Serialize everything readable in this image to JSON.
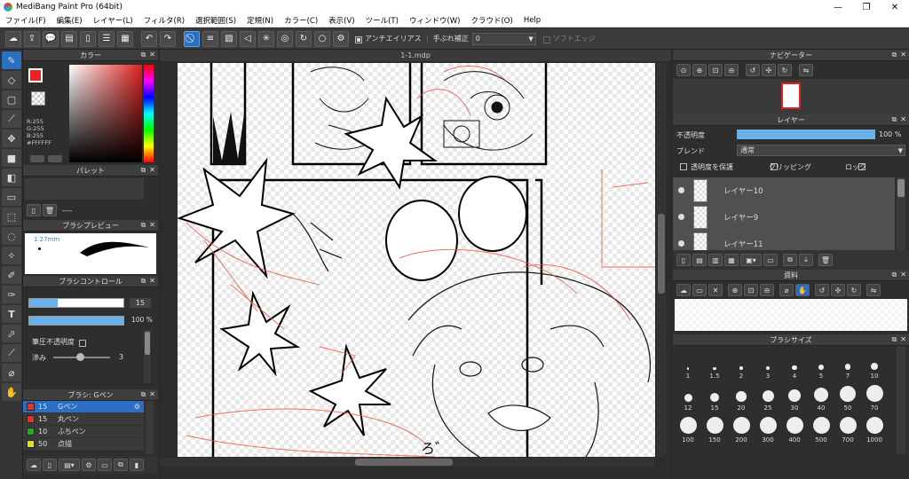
{
  "window": {
    "title": "MediBang Paint Pro (64bit)",
    "min": "—",
    "max": "❐",
    "close": "✕"
  },
  "menu": [
    "ファイル(F)",
    "編集(E)",
    "レイヤー(L)",
    "フィルタ(R)",
    "選択範囲(S)",
    "定規(N)",
    "カラー(C)",
    "表示(V)",
    "ツール(T)",
    "ウィンドウ(W)",
    "クラウド(O)",
    "Help"
  ],
  "toolbar": {
    "antialias": "アンチエイリアス",
    "stabilizer": "手ぶれ補正",
    "stabilizer_value": "0",
    "soft_edge": "ソフトエッジ"
  },
  "color_panel": {
    "title": "カラー",
    "r": "R:255",
    "g": "G:255",
    "b": "B:255",
    "hex": "#FFFFFF",
    "fg": "#ee2222",
    "bg": "#ffffff"
  },
  "palette_panel": {
    "title": "パレット",
    "empty_label": "----"
  },
  "brush_preview": {
    "title": "ブラシプレビュー",
    "size": "1.27mm"
  },
  "brush_control": {
    "title": "ブラシコントロール",
    "size_value": "15",
    "opacity_value": "100",
    "opacity_unit": "%",
    "pressure_opacity": "筆圧不透明度",
    "smoothing_label": "滲み",
    "smoothing_value": "3",
    "size_fill": 0.3,
    "opacity_fill": 1.0
  },
  "brush_list": {
    "title": "ブラシ: Gペン",
    "items": [
      {
        "size": "15",
        "name": "Gペン",
        "color": "#e83030",
        "selected": true
      },
      {
        "size": "15",
        "name": "丸ペン",
        "color": "#e83030",
        "selected": false
      },
      {
        "size": "10",
        "name": "ふちペン",
        "color": "#22aa22",
        "selected": false
      },
      {
        "size": "50",
        "name": "点描",
        "color": "#e8d820",
        "selected": false
      }
    ]
  },
  "canvas": {
    "tab": "1-1.mdp"
  },
  "navigator": {
    "title": "ナビゲーター"
  },
  "layer_panel": {
    "title": "レイヤー",
    "opacity_label": "不透明度",
    "opacity_value": "100",
    "opacity_unit": "%",
    "opacity_fill": 1.0,
    "blend_label": "ブレンド",
    "blend_value": "通常",
    "protect_alpha": "透明度を保護",
    "clipping": "クリッピング",
    "lock": "ロック",
    "layers": [
      {
        "name": "レイヤー10"
      },
      {
        "name": "レイヤー9"
      },
      {
        "name": "レイヤー11"
      }
    ]
  },
  "materials": {
    "title": "資料"
  },
  "brush_size": {
    "title": "ブラシサイズ",
    "sizes": [
      "1",
      "1.5",
      "2",
      "3",
      "4",
      "5",
      "7",
      "10",
      "12",
      "15",
      "20",
      "25",
      "30",
      "40",
      "50",
      "70",
      "100",
      "150",
      "200",
      "300",
      "400",
      "500",
      "700",
      "1000"
    ]
  }
}
